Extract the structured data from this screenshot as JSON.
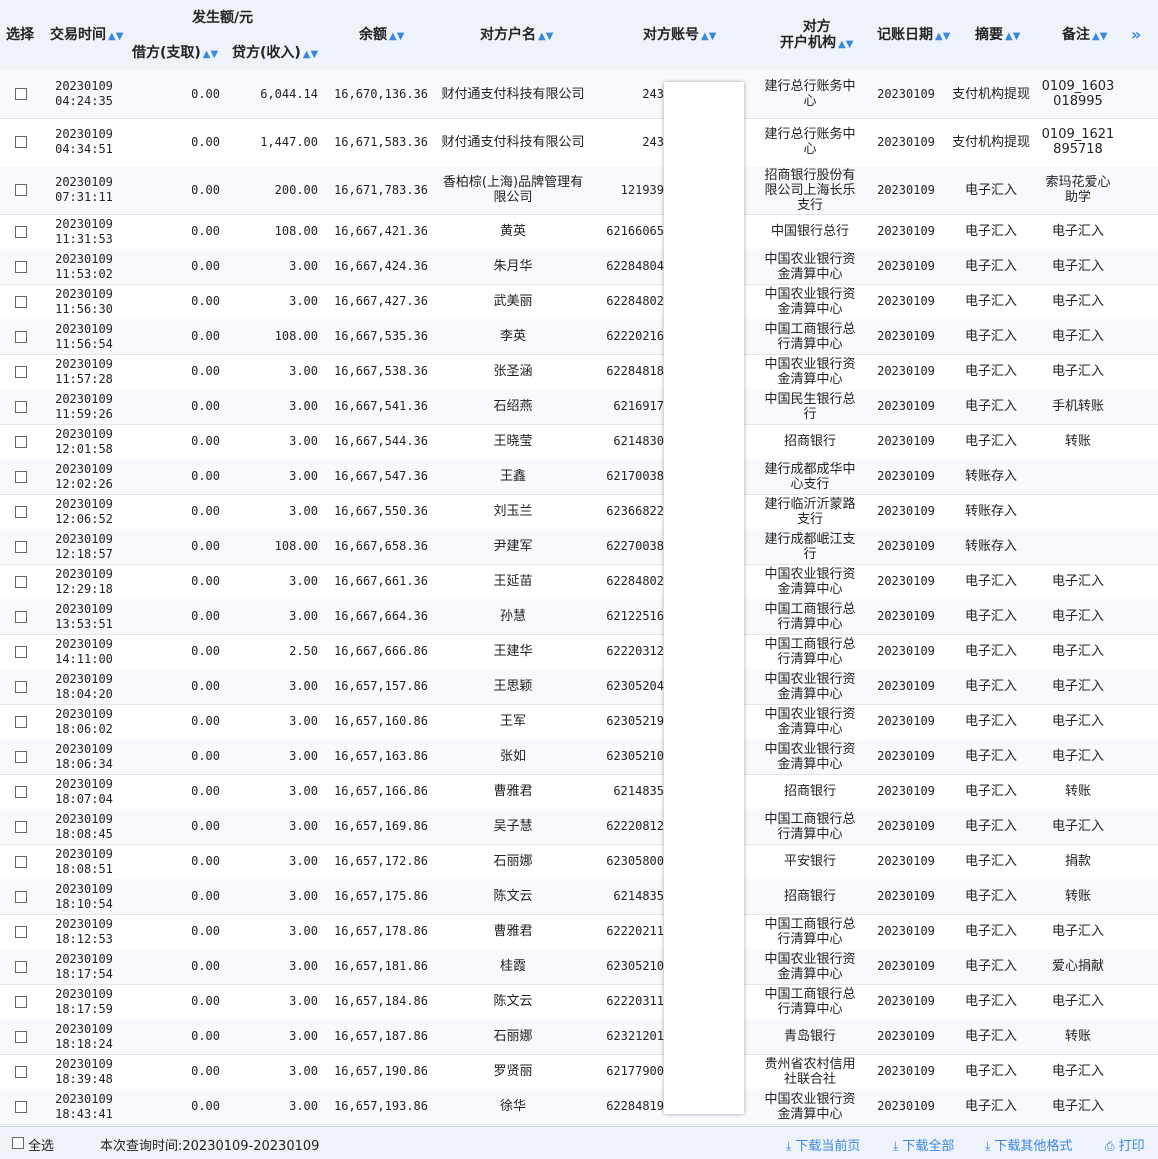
{
  "header": {
    "select": "选择",
    "time": "交易时间",
    "amount_group": "发生额/元",
    "debit": "借方(支取)",
    "credit": "贷方(收入)",
    "balance": "余额",
    "name": "对方户名",
    "account": "对方账号",
    "inst_line1": "对方",
    "inst_line2": "开户机构",
    "post_date": "记账日期",
    "summary": "摘要",
    "note": "备注",
    "sort_icon": "sort-arrows-icon",
    "next_icon": "double-chevron-right-icon"
  },
  "rows": [
    {
      "date": "20230109",
      "time": "04:24:35",
      "debit": "0.00",
      "credit": "6,044.14",
      "balance": "16,670,136.36",
      "name": "财付通支付科技有限公司",
      "account": "243",
      "inst": "建行总行账务中心",
      "post_date": "20230109",
      "summary": "支付机构提现",
      "note": "0109_1603018995"
    },
    {
      "date": "20230109",
      "time": "04:34:51",
      "debit": "0.00",
      "credit": "1,447.00",
      "balance": "16,671,583.36",
      "name": "财付通支付科技有限公司",
      "account": "243",
      "inst": "建行总行账务中心",
      "post_date": "20230109",
      "summary": "支付机构提现",
      "note": "0109_1621895718"
    },
    {
      "date": "20230109",
      "time": "07:31:11",
      "debit": "0.00",
      "credit": "200.00",
      "balance": "16,671,783.36",
      "name": "香柏棕(上海)品牌管理有限公司",
      "account": "121939",
      "inst": "招商银行股份有限公司上海长乐支行",
      "post_date": "20230109",
      "summary": "电子汇入",
      "note": "索玛花爱心助学"
    },
    {
      "date": "20230109",
      "time": "11:31:53",
      "debit": "0.00",
      "credit": "108.00",
      "balance": "16,667,421.36",
      "name": "黄英",
      "account": "62166065",
      "inst": "中国银行总行",
      "post_date": "20230109",
      "summary": "电子汇入",
      "note": "电子汇入"
    },
    {
      "date": "20230109",
      "time": "11:53:02",
      "debit": "0.00",
      "credit": "3.00",
      "balance": "16,667,424.36",
      "name": "朱月华",
      "account": "62284804",
      "inst": "中国农业银行资金清算中心",
      "post_date": "20230109",
      "summary": "电子汇入",
      "note": "电子汇入"
    },
    {
      "date": "20230109",
      "time": "11:56:30",
      "debit": "0.00",
      "credit": "3.00",
      "balance": "16,667,427.36",
      "name": "武美丽",
      "account": "62284802",
      "inst": "中国农业银行资金清算中心",
      "post_date": "20230109",
      "summary": "电子汇入",
      "note": "电子汇入"
    },
    {
      "date": "20230109",
      "time": "11:56:54",
      "debit": "0.00",
      "credit": "108.00",
      "balance": "16,667,535.36",
      "name": "李英",
      "account": "62220216",
      "inst": "中国工商银行总行清算中心",
      "post_date": "20230109",
      "summary": "电子汇入",
      "note": "电子汇入"
    },
    {
      "date": "20230109",
      "time": "11:57:28",
      "debit": "0.00",
      "credit": "3.00",
      "balance": "16,667,538.36",
      "name": "张圣涵",
      "account": "62284818",
      "inst": "中国农业银行资金清算中心",
      "post_date": "20230109",
      "summary": "电子汇入",
      "note": "电子汇入"
    },
    {
      "date": "20230109",
      "time": "11:59:26",
      "debit": "0.00",
      "credit": "3.00",
      "balance": "16,667,541.36",
      "name": "石绍燕",
      "account": "6216917",
      "inst": "中国民生银行总行",
      "post_date": "20230109",
      "summary": "电子汇入",
      "note": "手机转账"
    },
    {
      "date": "20230109",
      "time": "12:01:58",
      "debit": "0.00",
      "credit": "3.00",
      "balance": "16,667,544.36",
      "name": "王晓莹",
      "account": "6214830",
      "inst": "招商银行",
      "post_date": "20230109",
      "summary": "电子汇入",
      "note": "转账"
    },
    {
      "date": "20230109",
      "time": "12:02:26",
      "debit": "0.00",
      "credit": "3.00",
      "balance": "16,667,547.36",
      "name": "王鑫",
      "account": "62170038",
      "inst": "建行成都成华中心支行",
      "post_date": "20230109",
      "summary": "转账存入",
      "note": ""
    },
    {
      "date": "20230109",
      "time": "12:06:52",
      "debit": "0.00",
      "credit": "3.00",
      "balance": "16,667,550.36",
      "name": "刘玉兰",
      "account": "62366822",
      "inst": "建行临沂沂蒙路支行",
      "post_date": "20230109",
      "summary": "转账存入",
      "note": ""
    },
    {
      "date": "20230109",
      "time": "12:18:57",
      "debit": "0.00",
      "credit": "108.00",
      "balance": "16,667,658.36",
      "name": "尹建军",
      "account": "62270038",
      "inst": "建行成都岷江支行",
      "post_date": "20230109",
      "summary": "转账存入",
      "note": ""
    },
    {
      "date": "20230109",
      "time": "12:29:18",
      "debit": "0.00",
      "credit": "3.00",
      "balance": "16,667,661.36",
      "name": "王延苗",
      "account": "62284802",
      "inst": "中国农业银行资金清算中心",
      "post_date": "20230109",
      "summary": "电子汇入",
      "note": "电子汇入"
    },
    {
      "date": "20230109",
      "time": "13:53:51",
      "debit": "0.00",
      "credit": "3.00",
      "balance": "16,667,664.36",
      "name": "孙慧",
      "account": "62122516",
      "inst": "中国工商银行总行清算中心",
      "post_date": "20230109",
      "summary": "电子汇入",
      "note": "电子汇入"
    },
    {
      "date": "20230109",
      "time": "14:11:00",
      "debit": "0.00",
      "credit": "2.50",
      "balance": "16,667,666.86",
      "name": "王建华",
      "account": "62220312",
      "inst": "中国工商银行总行清算中心",
      "post_date": "20230109",
      "summary": "电子汇入",
      "note": "电子汇入"
    },
    {
      "date": "20230109",
      "time": "18:04:20",
      "debit": "0.00",
      "credit": "3.00",
      "balance": "16,657,157.86",
      "name": "王思颖",
      "account": "62305204",
      "inst": "中国农业银行资金清算中心",
      "post_date": "20230109",
      "summary": "电子汇入",
      "note": "电子汇入"
    },
    {
      "date": "20230109",
      "time": "18:06:02",
      "debit": "0.00",
      "credit": "3.00",
      "balance": "16,657,160.86",
      "name": "王军",
      "account": "62305219",
      "inst": "中国农业银行资金清算中心",
      "post_date": "20230109",
      "summary": "电子汇入",
      "note": "电子汇入"
    },
    {
      "date": "20230109",
      "time": "18:06:34",
      "debit": "0.00",
      "credit": "3.00",
      "balance": "16,657,163.86",
      "name": "张如",
      "account": "62305210",
      "inst": "中国农业银行资金清算中心",
      "post_date": "20230109",
      "summary": "电子汇入",
      "note": "电子汇入"
    },
    {
      "date": "20230109",
      "time": "18:07:04",
      "debit": "0.00",
      "credit": "3.00",
      "balance": "16,657,166.86",
      "name": "曹雅君",
      "account": "6214835",
      "inst": "招商银行",
      "post_date": "20230109",
      "summary": "电子汇入",
      "note": "转账"
    },
    {
      "date": "20230109",
      "time": "18:08:45",
      "debit": "0.00",
      "credit": "3.00",
      "balance": "16,657,169.86",
      "name": "吴子慧",
      "account": "62220812",
      "inst": "中国工商银行总行清算中心",
      "post_date": "20230109",
      "summary": "电子汇入",
      "note": "电子汇入"
    },
    {
      "date": "20230109",
      "time": "18:08:51",
      "debit": "0.00",
      "credit": "3.00",
      "balance": "16,657,172.86",
      "name": "石丽娜",
      "account": "62305800",
      "inst": "平安银行",
      "post_date": "20230109",
      "summary": "电子汇入",
      "note": "捐款"
    },
    {
      "date": "20230109",
      "time": "18:10:54",
      "debit": "0.00",
      "credit": "3.00",
      "balance": "16,657,175.86",
      "name": "陈文云",
      "account": "6214835",
      "inst": "招商银行",
      "post_date": "20230109",
      "summary": "电子汇入",
      "note": "转账"
    },
    {
      "date": "20230109",
      "time": "18:12:53",
      "debit": "0.00",
      "credit": "3.00",
      "balance": "16,657,178.86",
      "name": "曹雅君",
      "account": "62220211",
      "inst": "中国工商银行总行清算中心",
      "post_date": "20230109",
      "summary": "电子汇入",
      "note": "电子汇入"
    },
    {
      "date": "20230109",
      "time": "18:17:54",
      "debit": "0.00",
      "credit": "3.00",
      "balance": "16,657,181.86",
      "name": "桂霞",
      "account": "62305210",
      "inst": "中国农业银行资金清算中心",
      "post_date": "20230109",
      "summary": "电子汇入",
      "note": "爱心捐献"
    },
    {
      "date": "20230109",
      "time": "18:17:59",
      "debit": "0.00",
      "credit": "3.00",
      "balance": "16,657,184.86",
      "name": "陈文云",
      "account": "62220311",
      "inst": "中国工商银行总行清算中心",
      "post_date": "20230109",
      "summary": "电子汇入",
      "note": "电子汇入"
    },
    {
      "date": "20230109",
      "time": "18:18:24",
      "debit": "0.00",
      "credit": "3.00",
      "balance": "16,657,187.86",
      "name": "石丽娜",
      "account": "62321201",
      "inst": "青岛银行",
      "post_date": "20230109",
      "summary": "电子汇入",
      "note": "转账"
    },
    {
      "date": "20230109",
      "time": "18:39:48",
      "debit": "0.00",
      "credit": "3.00",
      "balance": "16,657,190.86",
      "name": "罗贤丽",
      "account": "62177900",
      "inst": "贵州省农村信用社联合社",
      "post_date": "20230109",
      "summary": "电子汇入",
      "note": "电子汇入"
    },
    {
      "date": "20230109",
      "time": "18:43:41",
      "debit": "0.00",
      "credit": "3.00",
      "balance": "16,657,193.86",
      "name": "徐华",
      "account": "62284819",
      "inst": "中国农业银行资金清算中心",
      "post_date": "20230109",
      "summary": "电子汇入",
      "note": "电子汇入"
    }
  ],
  "footer": {
    "select_all": "全选",
    "query_range": "本次查询时间:20230109-20230109",
    "download_current": "下载当前页",
    "download_all": "下载全部",
    "download_other": "下载其他格式",
    "print": "打印",
    "download_icon": "download-icon",
    "print_icon": "printer-icon"
  }
}
